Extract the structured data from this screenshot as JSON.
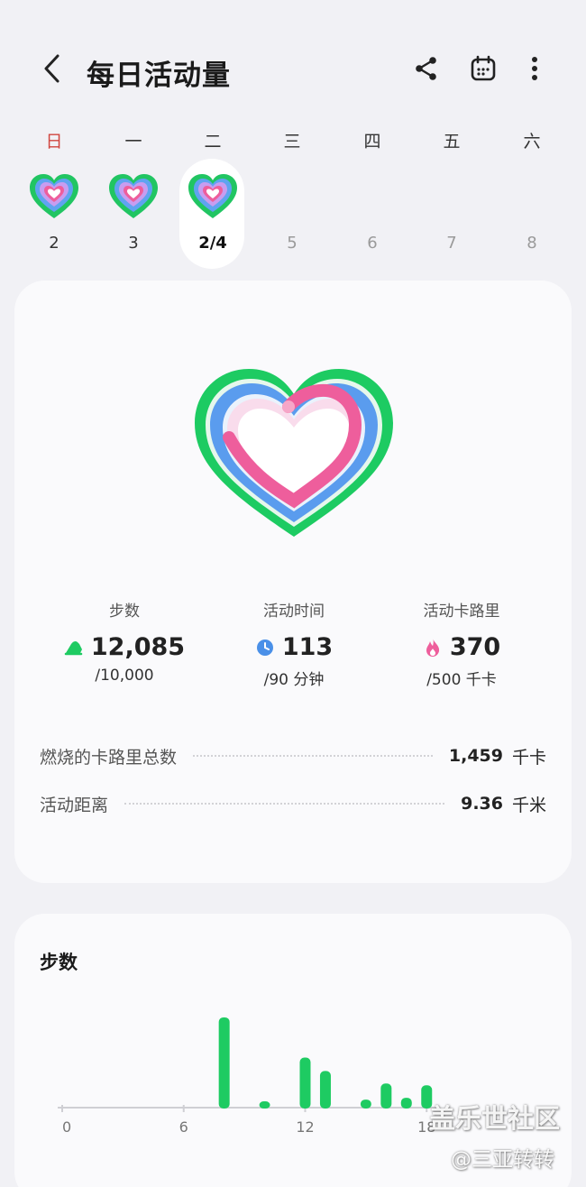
{
  "header": {
    "title": "每日活动量",
    "back_icon": "chevron-left-icon",
    "actions": [
      "share-icon",
      "calendar-icon",
      "more-vertical-icon"
    ]
  },
  "week": {
    "days": [
      {
        "name": "日",
        "num": "2",
        "has_heart": true
      },
      {
        "name": "一",
        "num": "3",
        "has_heart": true
      },
      {
        "name": "二",
        "num": "2/4",
        "has_heart": true,
        "selected": true
      },
      {
        "name": "三",
        "num": "5",
        "has_heart": false
      },
      {
        "name": "四",
        "num": "6",
        "has_heart": false
      },
      {
        "name": "五",
        "num": "7",
        "has_heart": false
      },
      {
        "name": "六",
        "num": "8",
        "has_heart": false
      }
    ]
  },
  "colors": {
    "steps_green": "#1ecb62",
    "active_blue": "#4a90e8",
    "calorie_pink": "#ee5e9c",
    "sunday_red": "#d0453e"
  },
  "summary": {
    "steps": {
      "label": "步数",
      "value": "12,085",
      "goal": "/10,000",
      "icon": "running-shoe-icon"
    },
    "active_time": {
      "label": "活动时间",
      "value": "113",
      "goal": "/90 分钟",
      "icon": "clock-icon"
    },
    "active_calories": {
      "label": "活动卡路里",
      "value": "370",
      "goal": "/500 千卡",
      "icon": "flame-icon"
    }
  },
  "details": [
    {
      "label": "燃烧的卡路里总数",
      "value": "1,459",
      "unit": "千卡"
    },
    {
      "label": "活动距离",
      "value": "9.36",
      "unit": "千米"
    }
  ],
  "steps_card": {
    "title": "步数"
  },
  "chart_data": {
    "type": "bar",
    "title": "步数",
    "x_ticks": [
      "0",
      "6",
      "12",
      "18"
    ],
    "x": [
      8,
      10,
      12,
      13,
      15,
      16,
      17,
      18
    ],
    "values": [
      1000,
      60,
      550,
      400,
      80,
      260,
      100,
      240
    ],
    "xlim": [
      0,
      24
    ],
    "ylim": [
      0,
      1050
    ],
    "color": "#1ecb62",
    "grid": false
  },
  "watermark": {
    "line1": "盖乐世社区",
    "line2": "@三亚转转"
  }
}
